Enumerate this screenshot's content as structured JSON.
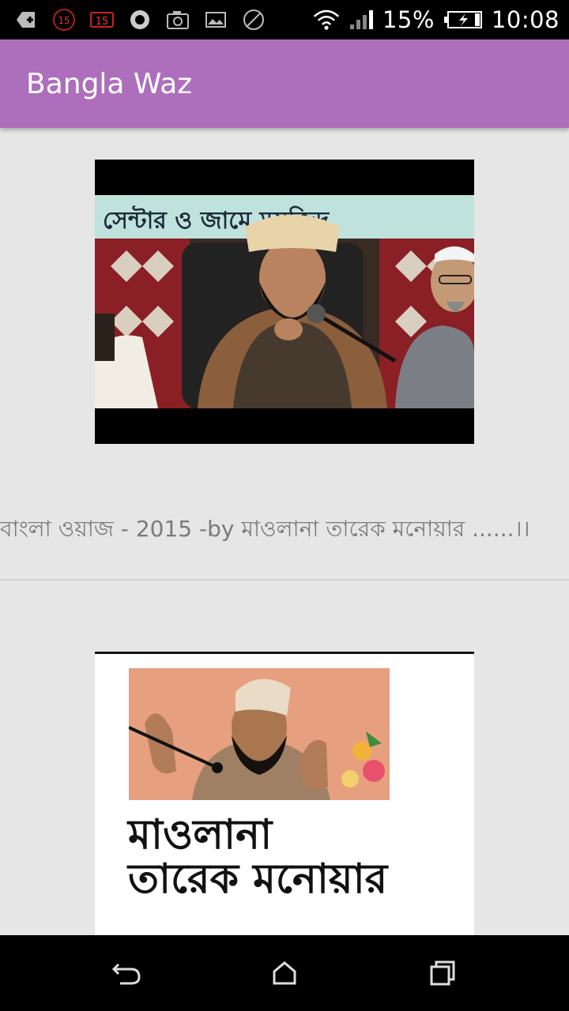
{
  "status_bar": {
    "battery_percent": "15%",
    "time": "10:08",
    "notification_badge_1": "15",
    "notification_badge_2": "15",
    "icons": [
      "add-icon",
      "badge-icon",
      "calendar-badge-icon",
      "opera-icon",
      "camera-icon",
      "image-icon",
      "blocked-icon",
      "wifi-icon",
      "signal-icon",
      "battery-charging-icon"
    ]
  },
  "app_bar": {
    "title": "Bangla Waz"
  },
  "items": [
    {
      "caption": "বাংলা ওয়াজ - 2015 -by মাওলানা তারেক মনোয়ার ......।।",
      "thumbnail_banner": "সেন্টার ও জামে মসজিদ"
    },
    {
      "title_line_1": "মাওলানা",
      "title_line_2": "তারেক মনোয়ার"
    }
  ],
  "nav_bar": {
    "icons": [
      "back-icon",
      "home-icon",
      "recents-icon"
    ]
  },
  "colors": {
    "app_bar": "#ad6fbc",
    "background": "#e6e6e6",
    "caption": "#7a7a7a"
  }
}
